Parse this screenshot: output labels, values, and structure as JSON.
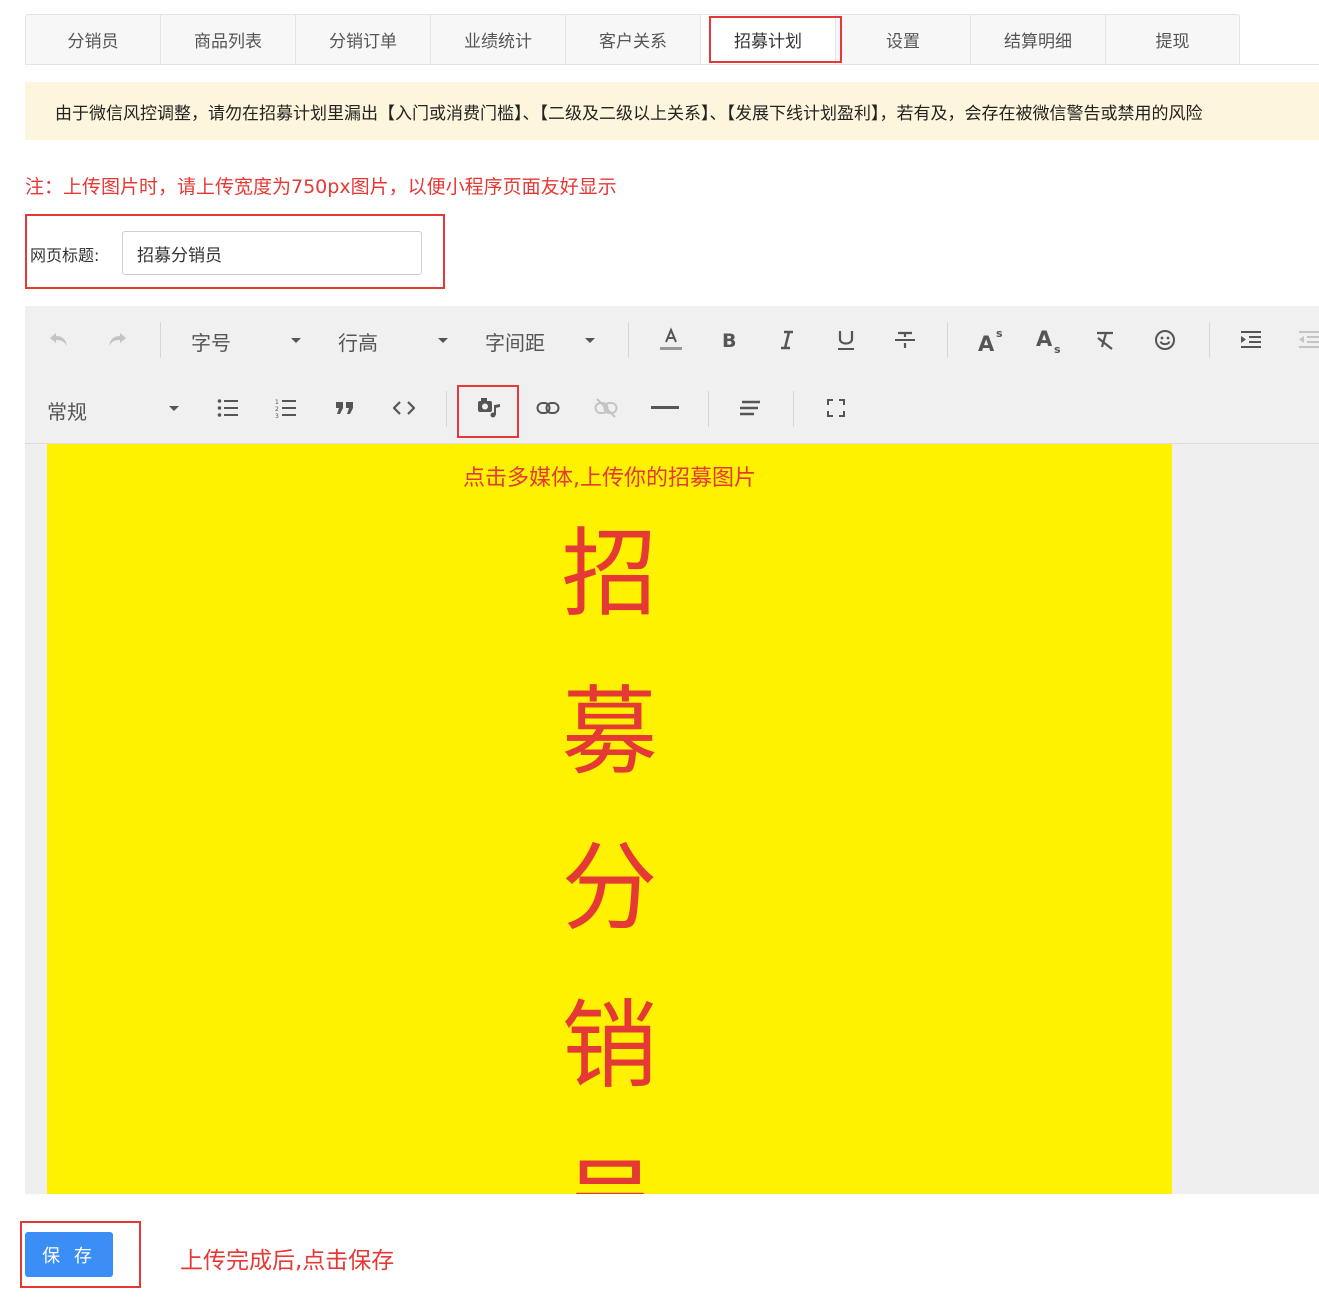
{
  "tabs": [
    {
      "label": "分销员"
    },
    {
      "label": "商品列表"
    },
    {
      "label": "分销订单"
    },
    {
      "label": "业绩统计"
    },
    {
      "label": "客户关系"
    },
    {
      "label": "招募计划",
      "active": true
    },
    {
      "label": "设置"
    },
    {
      "label": "结算明细"
    },
    {
      "label": "提现"
    }
  ],
  "notice": "由于微信风控调整，请勿在招募计划里漏出【入门或消费门槛】、【二级及二级以上关系】、【发展下线计划盈利】，若有及，会存在被微信警告或禁用的风险",
  "note": "注：上传图片时，请上传宽度为750px图片，以便小程序页面友好显示",
  "title_field": {
    "label": "网页标题:",
    "value": "招募分销员"
  },
  "toolbar": {
    "font_size": "字号",
    "line_height": "行高",
    "letter_spacing": "字间距",
    "paragraph": "常规",
    "icons": [
      "undo-icon",
      "redo-icon",
      "font-color-icon",
      "bold-icon",
      "italic-icon",
      "underline-icon",
      "strikethrough-icon",
      "superscript-icon",
      "subscript-icon",
      "clear-format-icon",
      "emoji-icon",
      "indent-icon",
      "outdent-icon",
      "bullet-list-icon",
      "numbered-list-icon",
      "blockquote-icon",
      "code-icon",
      "media-icon",
      "link-icon",
      "unlink-icon",
      "horizontal-rule-icon",
      "align-icon",
      "fullscreen-icon"
    ]
  },
  "editor": {
    "hint": "点击多媒体,上传你的招募图片",
    "poster_chars": [
      "招",
      "募",
      "分",
      "销",
      "员"
    ]
  },
  "save_button": "保 存",
  "save_hint": "上传完成后,点击保存",
  "colors": {
    "highlight_red": "#e53935",
    "poster_yellow": "#fff200",
    "primary_blue": "#3a8ef6",
    "notice_bg": "#fdf6dd"
  }
}
